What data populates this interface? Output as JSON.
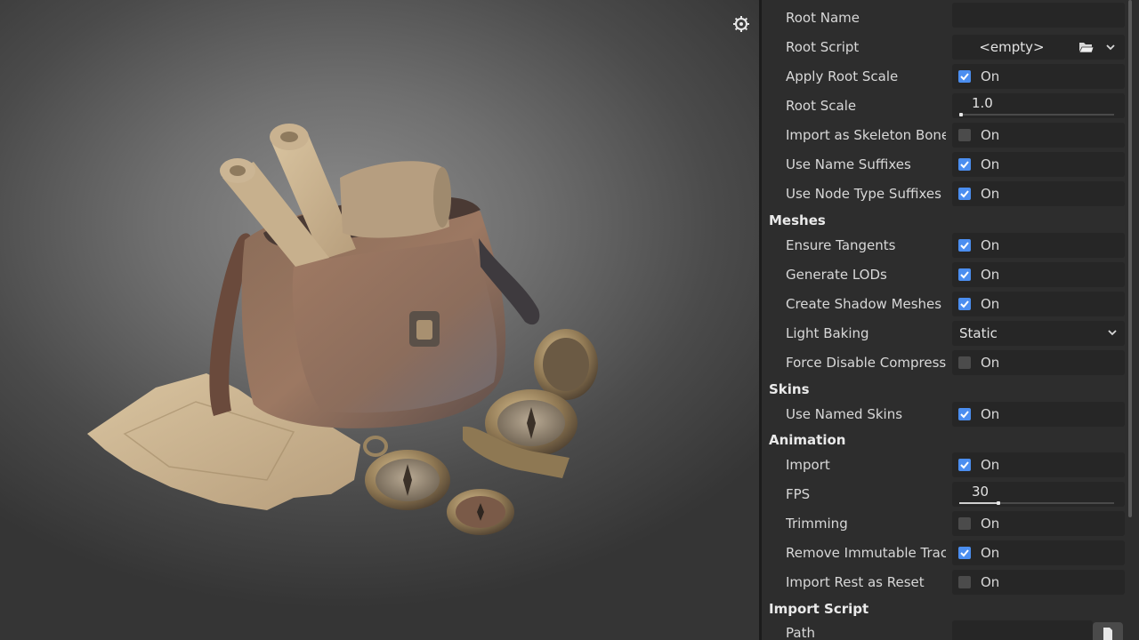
{
  "inspector": {
    "rows": {
      "root_name": {
        "label": "Root Name",
        "value": ""
      },
      "root_script": {
        "label": "Root Script",
        "value": "<empty>"
      },
      "apply_root_scale": {
        "label": "Apply Root Scale",
        "state": "On",
        "checked": true
      },
      "root_scale": {
        "label": "Root Scale",
        "value": "1.0",
        "slider_fraction": 0.0
      },
      "import_skeleton_bone": {
        "label": "Import as Skeleton Bone",
        "state": "On",
        "checked": false
      },
      "use_name_suffixes": {
        "label": "Use Name Suffixes",
        "state": "On",
        "checked": true
      },
      "use_node_type_suffixes": {
        "label": "Use Node Type Suffixes",
        "state": "On",
        "checked": true
      },
      "ensure_tangents": {
        "label": "Ensure Tangents",
        "state": "On",
        "checked": true
      },
      "generate_lods": {
        "label": "Generate LODs",
        "state": "On",
        "checked": true
      },
      "create_shadow_meshes": {
        "label": "Create Shadow Meshes",
        "state": "On",
        "checked": true
      },
      "light_baking": {
        "label": "Light Baking",
        "value": "Static"
      },
      "force_disable_compression": {
        "label": "Force Disable Compressi",
        "state": "On",
        "checked": false
      },
      "use_named_skins": {
        "label": "Use Named Skins",
        "state": "On",
        "checked": true
      },
      "import": {
        "label": "Import",
        "state": "On",
        "checked": true
      },
      "fps": {
        "label": "FPS",
        "value": "30",
        "slider_fraction": 0.25
      },
      "trimming": {
        "label": "Trimming",
        "state": "On",
        "checked": false
      },
      "remove_immutable_tracks": {
        "label": "Remove Immutable Trac",
        "state": "On",
        "checked": true
      },
      "import_rest_as_reset": {
        "label": "Import Rest as Reset",
        "state": "On",
        "checked": false
      },
      "path": {
        "label": "Path",
        "value": ""
      }
    },
    "sections": {
      "meshes": "Meshes",
      "skins": "Skins",
      "animation": "Animation",
      "import_script": "Import Script"
    }
  },
  "viewport": {
    "gizmo_icon": "gear-icon",
    "scene": "3d-model-preview"
  },
  "colors": {
    "accent": "#4b8ef0",
    "panel_bg": "#2d2d2d",
    "field_bg": "#262626"
  }
}
